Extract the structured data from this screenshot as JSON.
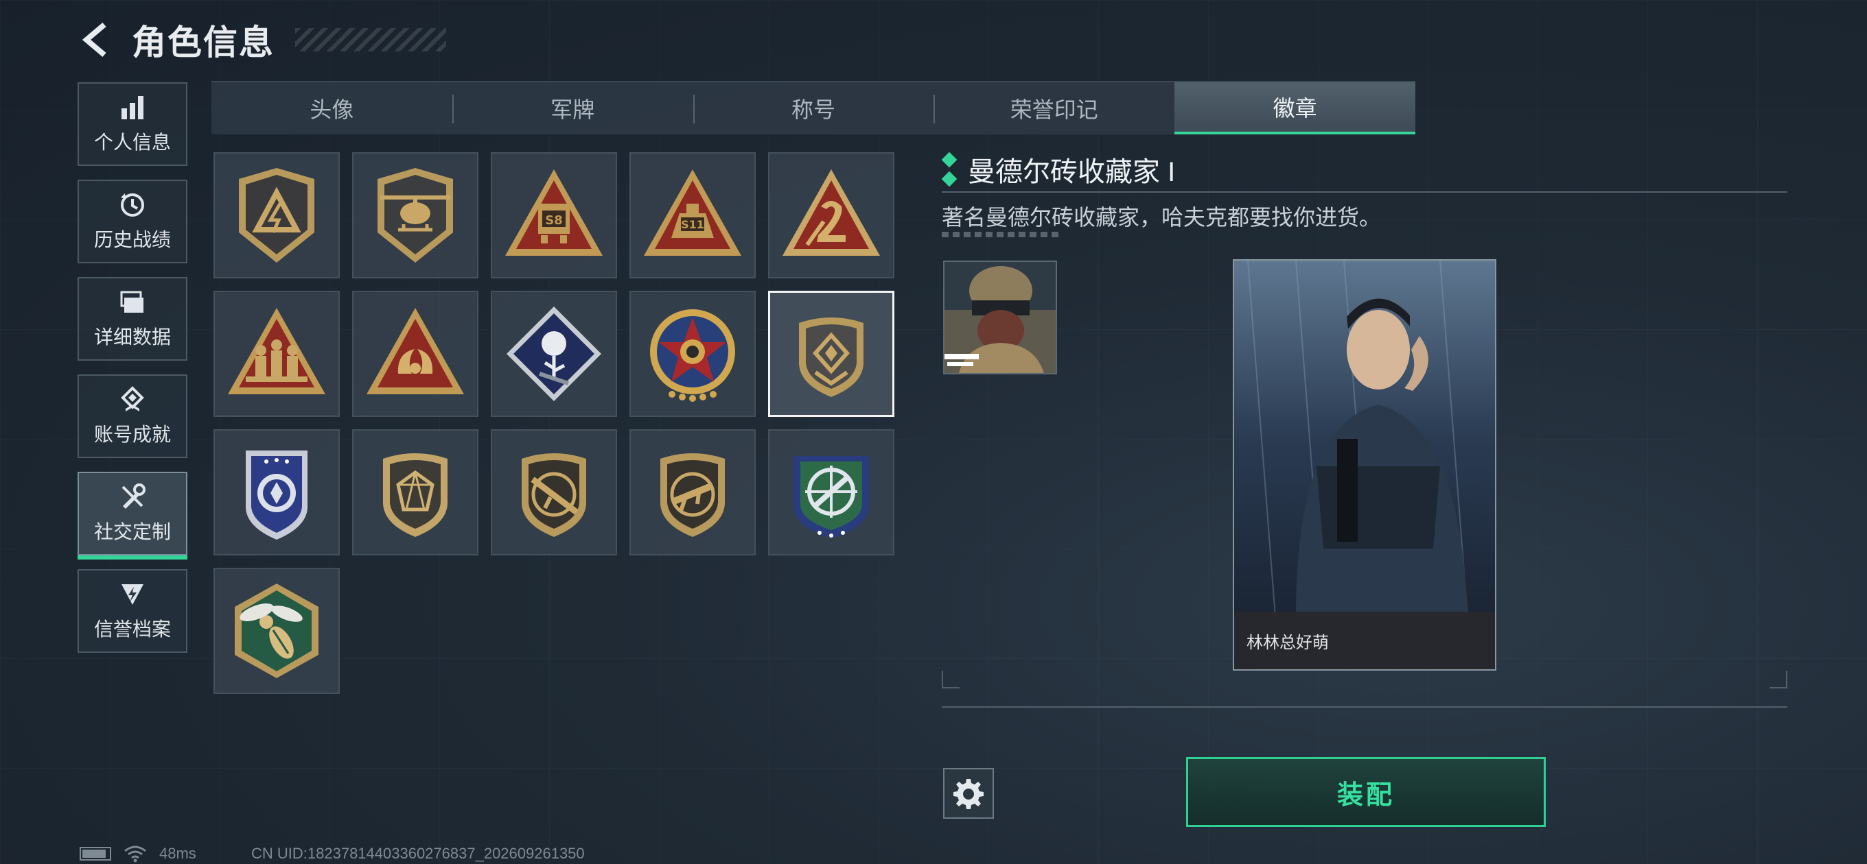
{
  "header": {
    "title": "角色信息"
  },
  "sidebar": {
    "items": [
      {
        "label": "个人信息",
        "icon": "bar-chart-icon"
      },
      {
        "label": "历史战绩",
        "icon": "history-clock-icon"
      },
      {
        "label": "详细数据",
        "icon": "folder-stack-icon"
      },
      {
        "label": "账号成就",
        "icon": "achievement-medal-icon"
      },
      {
        "label": "社交定制",
        "icon": "wrench-screwdriver-icon",
        "active": true
      },
      {
        "label": "信誉档案",
        "icon": "credit-shield-icon"
      }
    ]
  },
  "tabs": [
    {
      "label": "头像"
    },
    {
      "label": "军牌"
    },
    {
      "label": "称号"
    },
    {
      "label": "荣誉印记"
    },
    {
      "label": "徽章",
      "active": true
    }
  ],
  "badges": [
    {
      "icon": "delta-shield-badge-icon"
    },
    {
      "icon": "helicopter-shield-badge-icon"
    },
    {
      "icon": "s8-triangle-badge-icon"
    },
    {
      "icon": "s11-triangle-badge-icon"
    },
    {
      "icon": "number-2-triangle-badge-icon"
    },
    {
      "icon": "soldiers-triangle-badge-icon"
    },
    {
      "icon": "koi-triangle-badge-icon"
    },
    {
      "icon": "rose-diamond-badge-icon"
    },
    {
      "icon": "star-medallion-badge-icon"
    },
    {
      "icon": "brick-shield-badge-icon",
      "selected": true
    },
    {
      "icon": "blue-wreath-shield-badge-icon"
    },
    {
      "icon": "gem-shield-badge-icon"
    },
    {
      "icon": "rifle-shield-badge-icon"
    },
    {
      "icon": "smg-shield-badge-icon"
    },
    {
      "icon": "crosshair-wreath-badge-icon"
    },
    {
      "icon": "wasp-hexagon-badge-icon"
    }
  ],
  "detail": {
    "name": "曼德尔砖收藏家 I",
    "description": "著名曼德尔砖收藏家，哈夫克都要找你进货。"
  },
  "card": {
    "player_name": "林林总好萌"
  },
  "actions": {
    "equip_label": "装配"
  },
  "status": {
    "ping": "48ms",
    "uid": "CN UID:18237814403360276837_202609261350"
  },
  "colors": {
    "accent": "#35d59a",
    "equip_border": "#2fd193"
  }
}
